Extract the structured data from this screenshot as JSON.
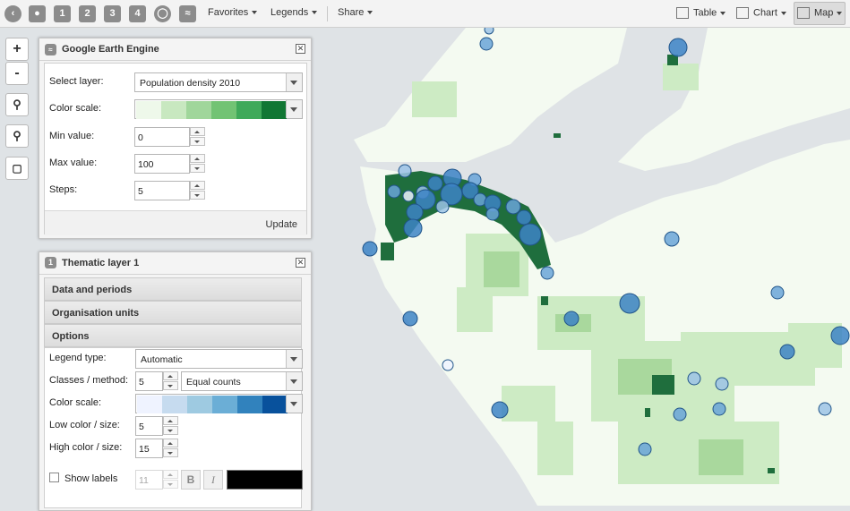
{
  "toolbar": {
    "favorites": "Favorites",
    "legends": "Legends",
    "share": "Share",
    "table": "Table",
    "chart": "Chart",
    "map": "Map",
    "layer_buttons": [
      "1",
      "2",
      "3",
      "4"
    ]
  },
  "map_controls": {
    "zoom_in": "+",
    "zoom_out": "-"
  },
  "gee_panel": {
    "title": "Google Earth Engine",
    "select_layer_label": "Select layer:",
    "select_layer_value": "Population density 2010",
    "color_scale_label": "Color scale:",
    "color_scale": [
      "#eef8ea",
      "#c8e8c0",
      "#a0d69b",
      "#72c374",
      "#3fa95a",
      "#117734"
    ],
    "min_label": "Min value:",
    "min_value": "0",
    "max_label": "Max value:",
    "max_value": "100",
    "steps_label": "Steps:",
    "steps_value": "5",
    "update": "Update"
  },
  "thematic_panel": {
    "title": "Thematic layer 1",
    "badge": "1",
    "sections": [
      "Data and periods",
      "Organisation units",
      "Options"
    ],
    "legend_type_label": "Legend type:",
    "legend_type_value": "Automatic",
    "classes_label": "Classes / method:",
    "classes_value": "5",
    "method_value": "Equal counts",
    "color_scale_label": "Color scale:",
    "color_scale": [
      "#eff3ff",
      "#c6dbef",
      "#9ecae1",
      "#6baed6",
      "#3182bd",
      "#08519c"
    ],
    "low_label": "Low color / size:",
    "low_value": "5",
    "high_label": "High color / size:",
    "high_value": "15",
    "show_labels": "Show labels",
    "font_size": "11",
    "bold": "B",
    "italic": "I"
  },
  "colors": {
    "land": "#f4faf1",
    "water": "#d9dcdf",
    "dense_green": "#1f6e3d",
    "mid_green": "#a9d89d",
    "light_green": "#cdebc4",
    "bubble": "#3d84c6",
    "bubble_stroke": "#21558a"
  }
}
